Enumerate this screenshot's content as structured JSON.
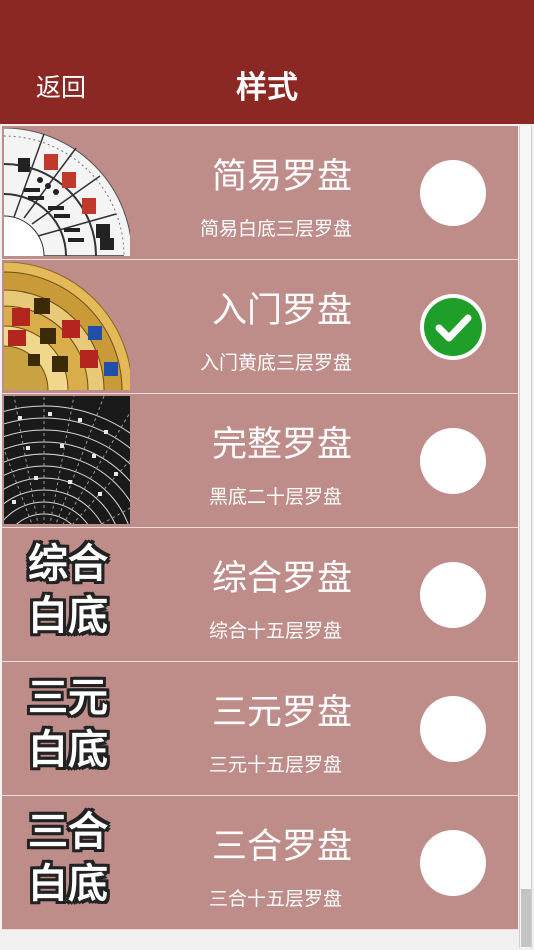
{
  "header": {
    "back_label": "返回",
    "title": "样式"
  },
  "options": [
    {
      "name": "简易罗盘",
      "desc": "简易白底三层罗盘",
      "selected": false
    },
    {
      "name": "入门罗盘",
      "desc": "入门黄底三层罗盘",
      "selected": true
    },
    {
      "name": "完整罗盘",
      "desc": "黑底二十层罗盘",
      "selected": false
    },
    {
      "name": "综合罗盘",
      "desc": "综合十五层罗盘",
      "selected": false,
      "logo_line1": "综合",
      "logo_line2": "白底"
    },
    {
      "name": "三元罗盘",
      "desc": "三元十五层罗盘",
      "selected": false,
      "logo_line1": "三元",
      "logo_line2": "白底"
    },
    {
      "name": "三合罗盘",
      "desc": "三合十五层罗盘",
      "selected": false,
      "logo_line1": "三合",
      "logo_line2": "白底"
    }
  ],
  "colors": {
    "header": "#8b2823",
    "row": "#bf8d89",
    "check": "#1f9e2a"
  }
}
